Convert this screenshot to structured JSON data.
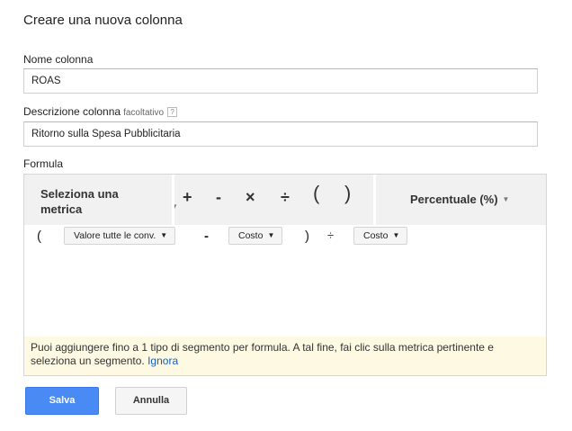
{
  "dialog": {
    "title": "Creare una nuova colonna"
  },
  "name_field": {
    "label": "Nome colonna",
    "value": "ROAS"
  },
  "description_field": {
    "label": "Descrizione colonna",
    "optional_hint": "facoltativo",
    "help_glyph": "?",
    "value": "Ritorno sulla Spesa Pubblicitaria"
  },
  "formula": {
    "label": "Formula",
    "toolbar": {
      "metric_select": "Seleziona una metrica",
      "operators": [
        "+",
        "-",
        "×",
        "÷",
        "(",
        ")"
      ],
      "format_select": "Percentuale (%)"
    },
    "expression": {
      "open_paren": "(",
      "metric1": "Valore tutte le conv.",
      "minus": "-",
      "metric2": "Costo",
      "close_paren": ")",
      "divide": "÷",
      "metric3": "Costo"
    },
    "notice": {
      "text": "Puoi aggiungere fino a 1 tipo di segmento per formula. A tal fine, fai clic sulla metrica pertinente e seleziona un segmento.",
      "link": "Ignora"
    }
  },
  "actions": {
    "save": "Salva",
    "cancel": "Annulla"
  },
  "icons": {
    "caret": "chevron-down-icon",
    "help": "help-icon"
  },
  "colors": {
    "primary": "#4a8af4",
    "link": "#1a5eb8",
    "notice_bg": "#fdf9e3",
    "toolbar_bg": "#f1f1f1"
  }
}
